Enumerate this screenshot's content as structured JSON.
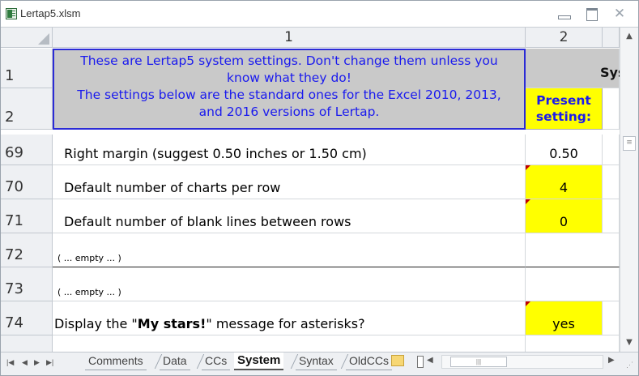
{
  "window": {
    "title": "Lertap5.xlsm",
    "minimize": "",
    "maximize": "",
    "close": "✕"
  },
  "columns": [
    "1",
    "2"
  ],
  "notice": {
    "line1": "These are Lertap5 system settings. Don't change them unless you",
    "line2": "know what they do!",
    "line3": "The settings below are the standard ones for the Excel 2010, 2013,",
    "line4": "and 2016 versions of Lertap."
  },
  "sheet_heading_fragment": "Sys",
  "present_header": {
    "line1": "Present",
    "line2": "setting:"
  },
  "rows": [
    {
      "num": "1"
    },
    {
      "num": "2"
    },
    {
      "num": "69",
      "label": "  Right margin (suggest 0.50 inches or 1.50 cm)",
      "value": "0.50"
    },
    {
      "num": "70",
      "label": "Default number of charts per row",
      "value": "4"
    },
    {
      "num": "71",
      "label": "Default number of blank lines between rows",
      "value": "0"
    },
    {
      "num": "72",
      "label": "( ... empty ... )",
      "value": ""
    },
    {
      "num": "73",
      "label": "( ... empty ... )",
      "value": ""
    },
    {
      "num": "74",
      "label_pre": "Display the \"",
      "label_bold": "My stars!",
      "label_post": "\" message for asterisks?",
      "value": "yes"
    }
  ],
  "tabs": [
    "Comments",
    "Data",
    "CCs",
    "System",
    "Syntax",
    "OldCCs"
  ],
  "active_tab": "System",
  "colors": {
    "yellow": "#ffff00",
    "gray": "#c9c9c9",
    "notice_text": "#1a1aee",
    "notice_border": "#2b2bd6"
  }
}
